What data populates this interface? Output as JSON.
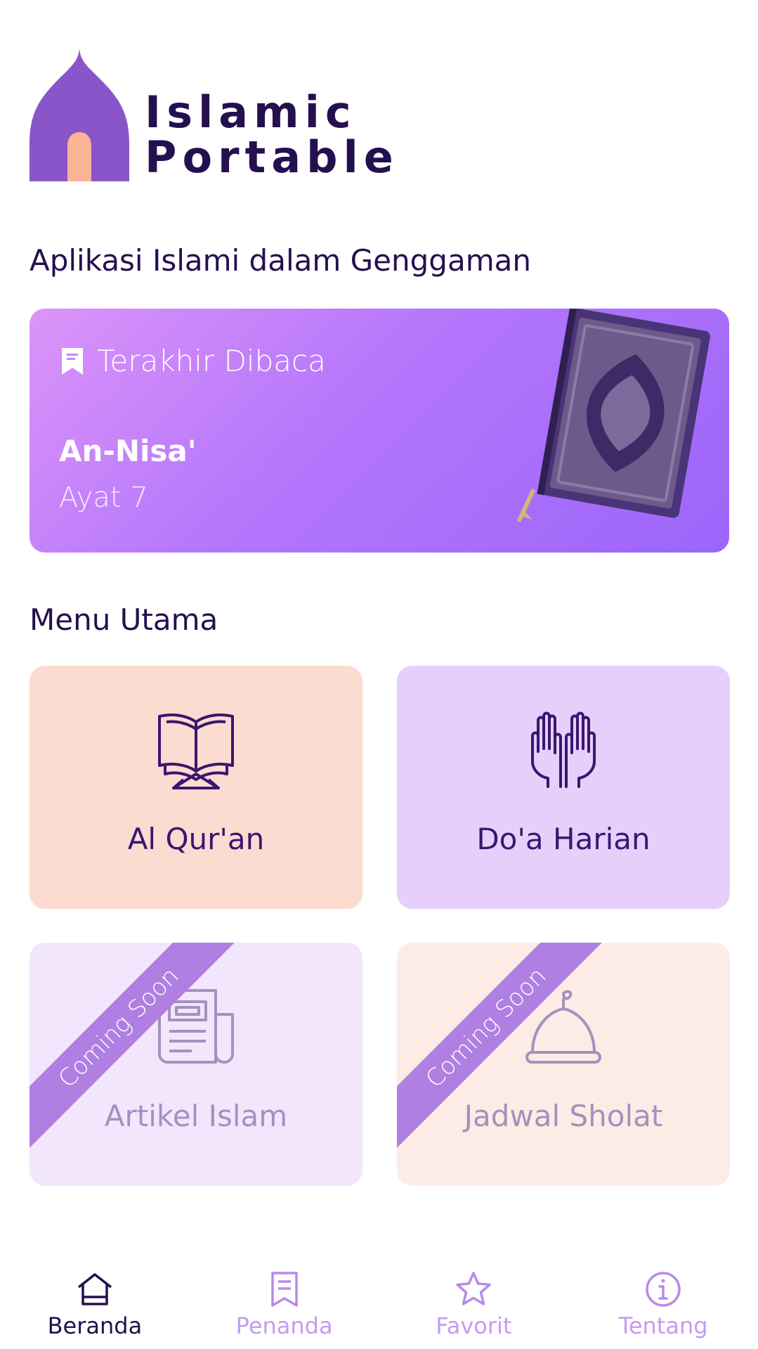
{
  "logo": {
    "line1": "Islamic",
    "line2": "Portable"
  },
  "tagline": "Aplikasi Islami dalam Genggaman",
  "last_read": {
    "title": "Terakhir Dibaca",
    "surah": "An-Nisa'",
    "ayat": "Ayat 7"
  },
  "menu": {
    "title": "Menu Utama",
    "items": [
      {
        "label": "Al Qur'an",
        "icon": "quran-icon",
        "available": true
      },
      {
        "label": "Do'a Harian",
        "icon": "praying-hands-icon",
        "available": true
      },
      {
        "label": "Artikel Islam",
        "icon": "newspaper-icon",
        "available": false,
        "ribbon": "Coming Soon"
      },
      {
        "label": "Jadwal Sholat",
        "icon": "mosque-dome-icon",
        "available": false,
        "ribbon": "Coming Soon"
      }
    ]
  },
  "bottom_nav": {
    "items": [
      {
        "label": "Beranda",
        "icon": "home-icon",
        "active": true
      },
      {
        "label": "Penanda",
        "icon": "bookmark-icon",
        "active": false
      },
      {
        "label": "Favorit",
        "icon": "star-icon",
        "active": false
      },
      {
        "label": "Tentang",
        "icon": "info-icon",
        "active": false
      }
    ]
  },
  "colors": {
    "primary_dark": "#24104f",
    "accent_purple": "#9c65fa",
    "nav_inactive": "#c49bef",
    "ribbon": "#b07fe2"
  }
}
